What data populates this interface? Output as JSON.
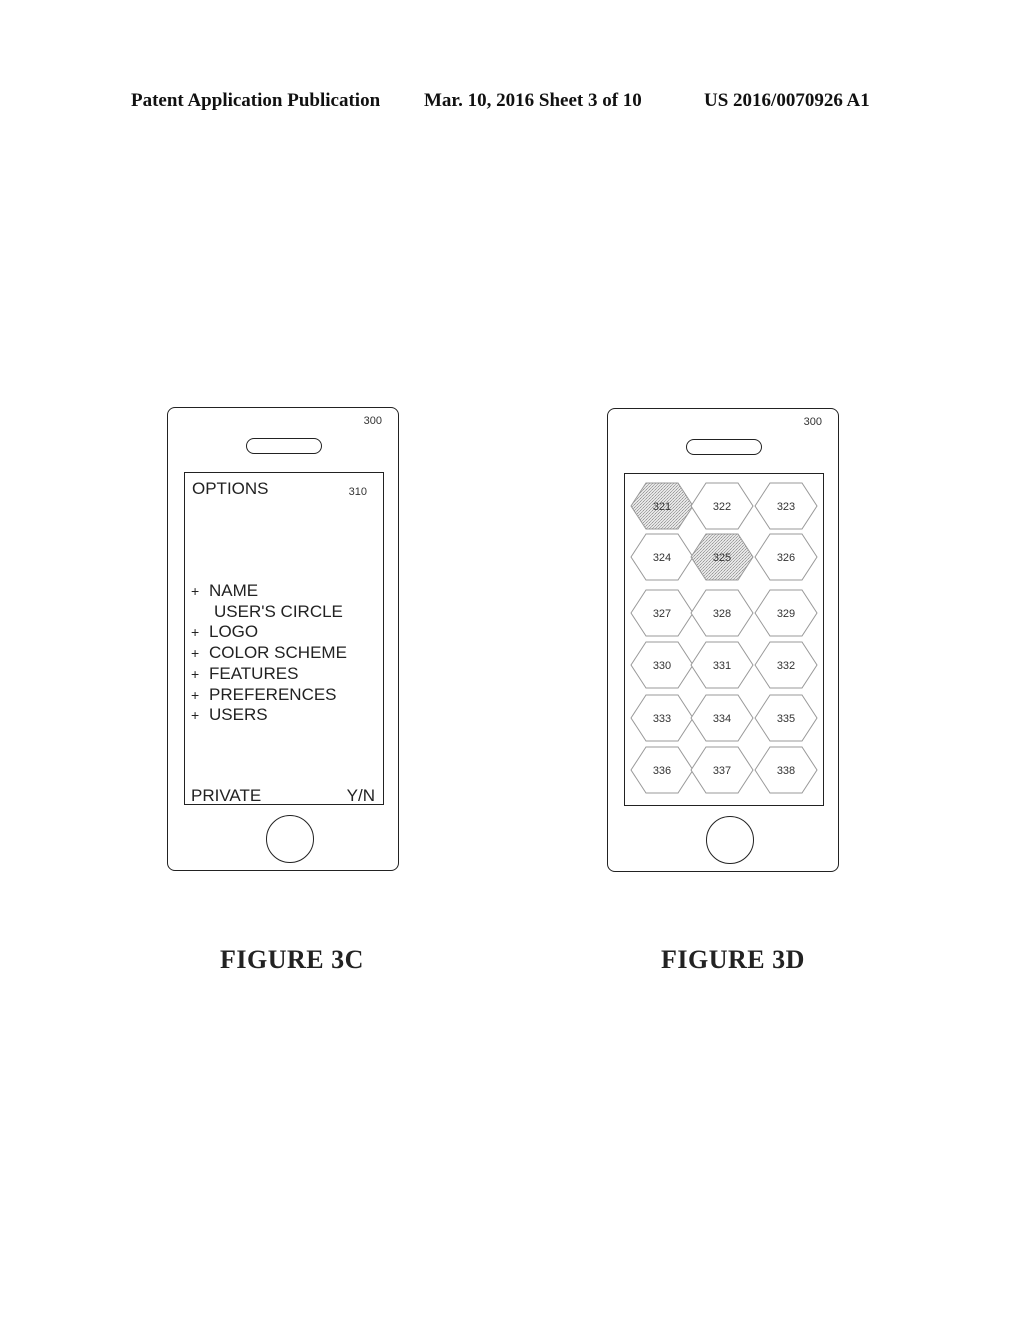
{
  "header": {
    "publication": "Patent Application Publication",
    "date_sheet": "Mar. 10, 2016  Sheet 3 of 10",
    "patent_number": "US 2016/0070926 A1"
  },
  "figure_3c": {
    "device_ref": "300",
    "screen_title": "OPTIONS",
    "screen_ref": "310",
    "items": [
      {
        "prefix": "+",
        "label": "NAME"
      },
      {
        "prefix": "",
        "label": "USER'S CIRCLE"
      },
      {
        "prefix": "+",
        "label": "LOGO"
      },
      {
        "prefix": "+",
        "label": "COLOR SCHEME"
      },
      {
        "prefix": "+",
        "label": "FEATURES"
      },
      {
        "prefix": "+",
        "label": "PREFERENCES"
      },
      {
        "prefix": "+",
        "label": "USERS"
      }
    ],
    "private_label": "PRIVATE",
    "private_value": "Y/N",
    "caption": "FIGURE 3C"
  },
  "figure_3d": {
    "device_ref": "300",
    "hexagons": [
      {
        "label": "321",
        "shaded": true
      },
      {
        "label": "322",
        "shaded": false
      },
      {
        "label": "323",
        "shaded": false
      },
      {
        "label": "324",
        "shaded": false
      },
      {
        "label": "325",
        "shaded": true
      },
      {
        "label": "326",
        "shaded": false
      },
      {
        "label": "327",
        "shaded": false
      },
      {
        "label": "328",
        "shaded": false
      },
      {
        "label": "329",
        "shaded": false
      },
      {
        "label": "330",
        "shaded": false
      },
      {
        "label": "331",
        "shaded": false
      },
      {
        "label": "332",
        "shaded": false
      },
      {
        "label": "333",
        "shaded": false
      },
      {
        "label": "334",
        "shaded": false
      },
      {
        "label": "335",
        "shaded": false
      },
      {
        "label": "336",
        "shaded": false
      },
      {
        "label": "337",
        "shaded": false
      },
      {
        "label": "338",
        "shaded": false
      }
    ],
    "caption": "FIGURE 3D"
  },
  "colors": {
    "line": "#222222",
    "hex_stroke": "#999999",
    "hex_shade": "#d4d4d4"
  }
}
